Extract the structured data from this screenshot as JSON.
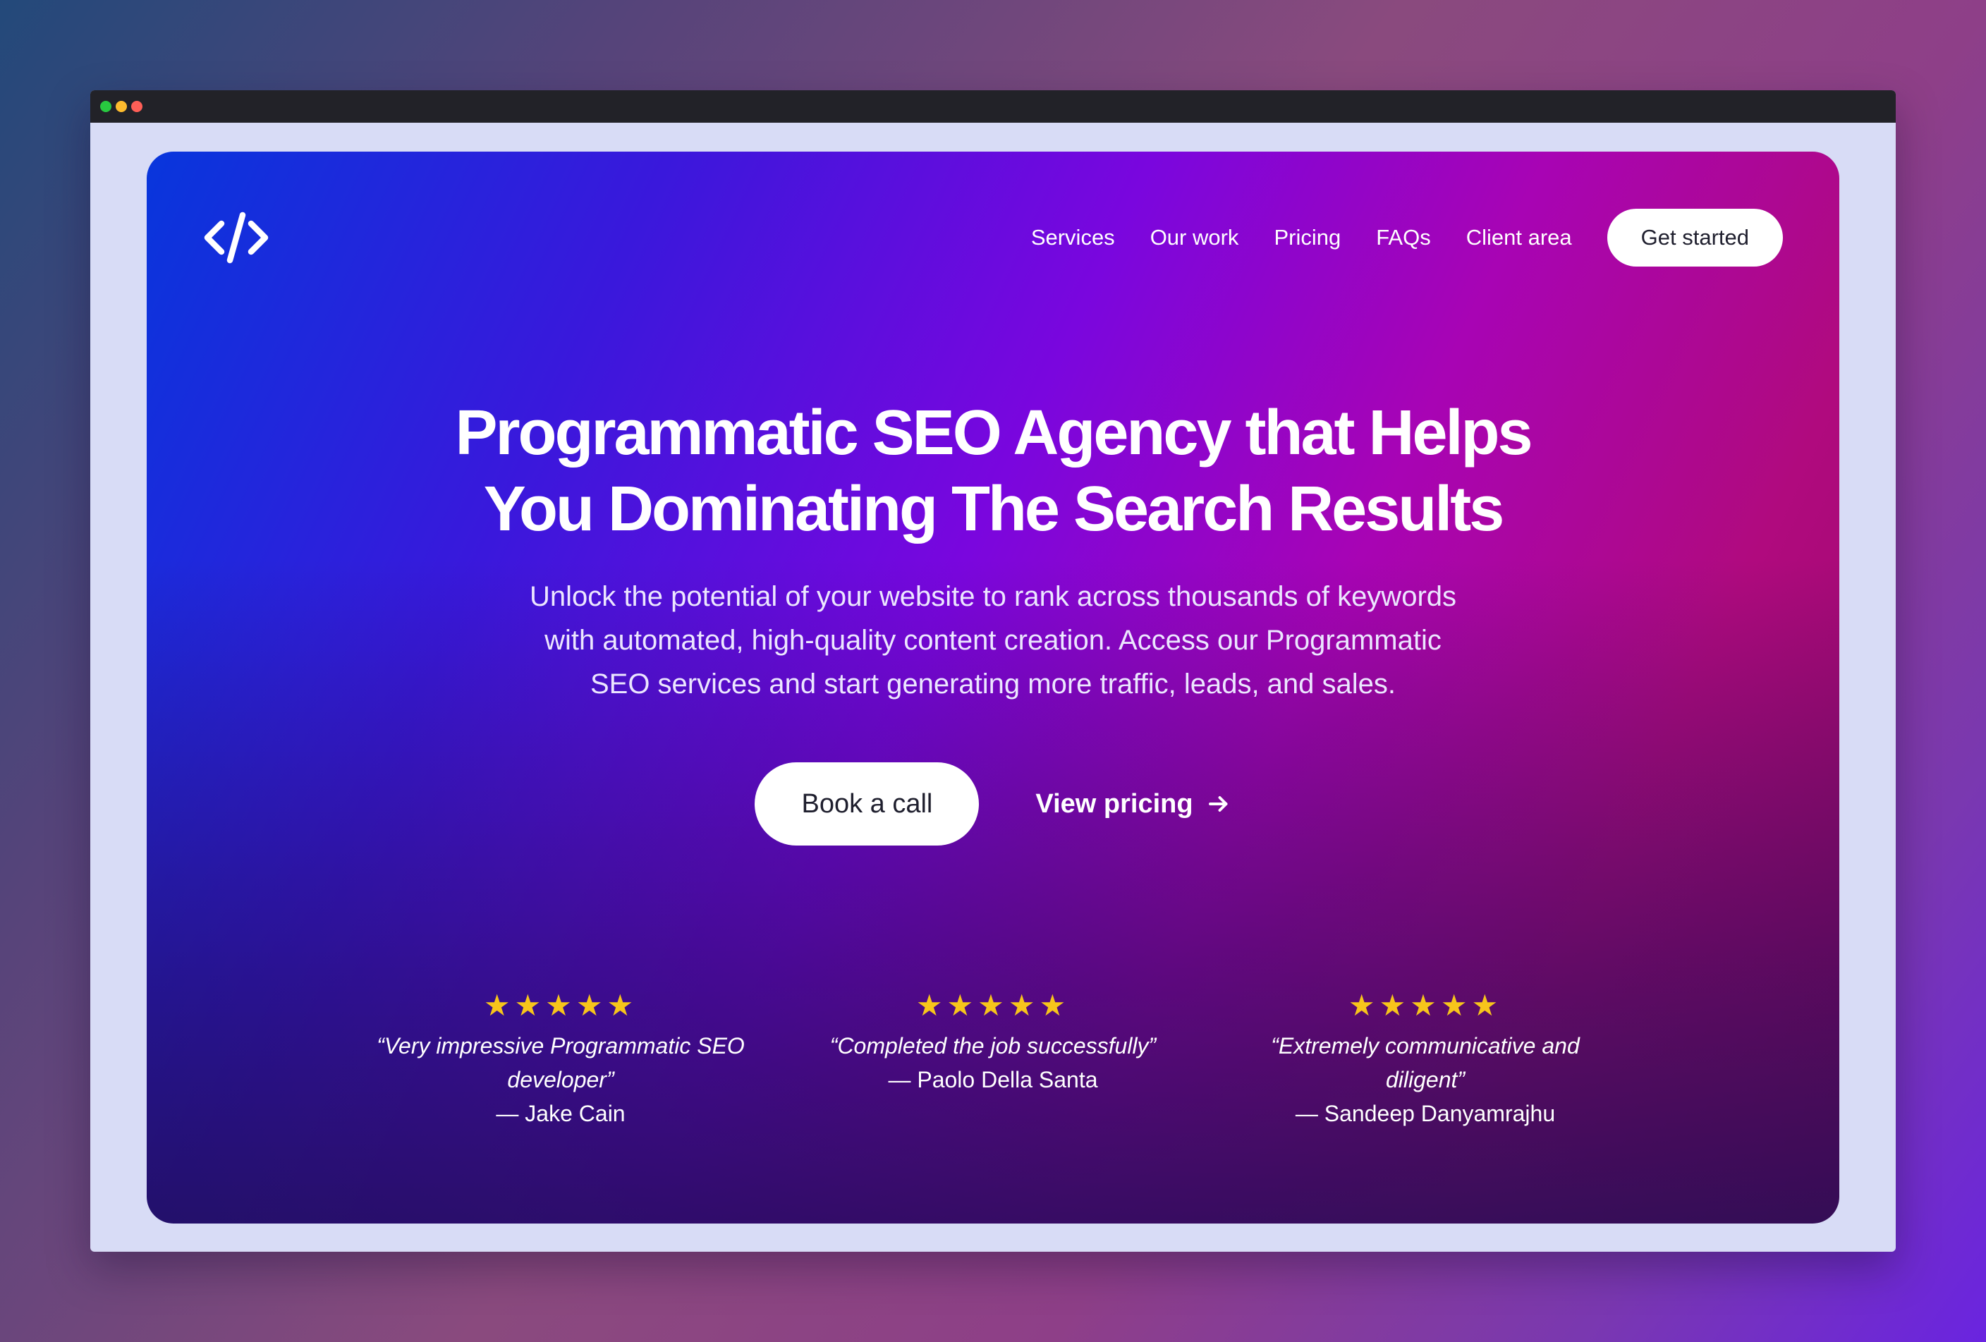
{
  "window": {
    "traffic_lights": [
      "#28c840",
      "#febc2e",
      "#ff5f57"
    ]
  },
  "header": {
    "logo_icon": "code-brackets-icon",
    "nav": [
      "Services",
      "Our work",
      "Pricing",
      "FAQs",
      "Client area"
    ],
    "cta_label": "Get started"
  },
  "hero": {
    "title_line1": "Programmatic SEO Agency that Helps",
    "title_line2": "You Dominating The Search Results",
    "subtitle_line1": "Unlock the potential of your website to rank across thousands of keywords",
    "subtitle_line2": "with automated, high-quality content creation. Access our Programmatic",
    "subtitle_line3": "SEO services and start generating more traffic, leads, and sales.",
    "primary_button": "Book a call",
    "secondary_link": "View pricing",
    "secondary_icon": "arrow-right-icon"
  },
  "reviews": [
    {
      "stars": "★★★★★",
      "rating": 5,
      "quote_line1": "“Very impressive Programmatic SEO",
      "quote_line2": "developer”",
      "author": "— Jake Cain"
    },
    {
      "stars": "★★★★★",
      "rating": 5,
      "quote_line1": "“Completed the job successfully”",
      "quote_line2": "",
      "author": "— Paolo Della Santa"
    },
    {
      "stars": "★★★★★",
      "rating": 5,
      "quote_line1": "“Extremely communicative and",
      "quote_line2": "diligent”",
      "author": "— Sandeep Danyamrajhu"
    }
  ],
  "colors": {
    "star": "#f7c51b",
    "button_bg": "#ffffff",
    "button_text": "#1f1f2e"
  }
}
